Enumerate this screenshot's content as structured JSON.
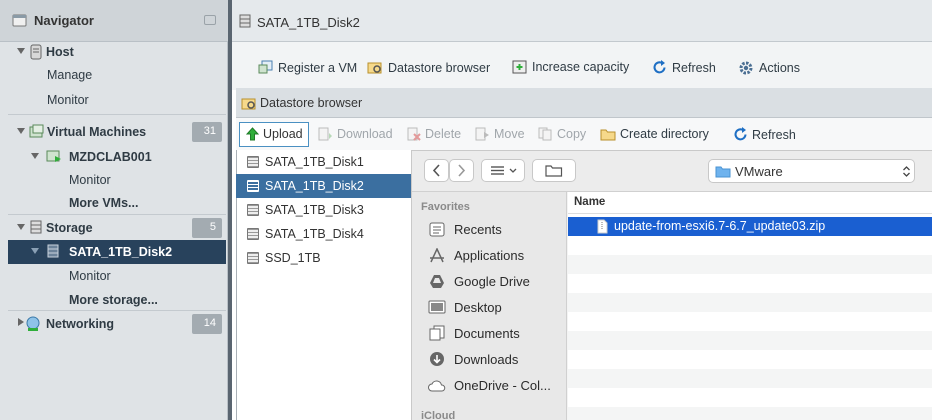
{
  "navigator": {
    "title": "Navigator",
    "host": {
      "label": "Host",
      "children": [
        "Manage",
        "Monitor"
      ]
    },
    "vms": {
      "label": "Virtual Machines",
      "count": "31",
      "vm": "MZDCLAB001",
      "vm_children": [
        "Monitor",
        "More VMs..."
      ]
    },
    "storage": {
      "label": "Storage",
      "count": "5",
      "ds": "SATA_1TB_Disk2",
      "ds_children": [
        "Monitor",
        "More storage..."
      ]
    },
    "networking": {
      "label": "Networking",
      "count": "14"
    }
  },
  "main": {
    "title": "SATA_1TB_Disk2",
    "toolbar": [
      "Register a VM",
      "Datastore browser",
      "Increase capacity",
      "Refresh",
      "Actions"
    ]
  },
  "dialog": {
    "title": "Datastore browser",
    "toolbar": {
      "upload": "Upload",
      "download": "Download",
      "delete": "Delete",
      "move": "Move",
      "copy": "Copy",
      "create_dir": "Create directory",
      "refresh": "Refresh"
    },
    "datastores": [
      "SATA_1TB_Disk1",
      "SATA_1TB_Disk2",
      "SATA_1TB_Disk3",
      "SATA_1TB_Disk4",
      "SSD_1TB"
    ],
    "selected_datastore": "SATA_1TB_Disk2"
  },
  "file_dialog": {
    "location": "VMware",
    "favorites_header": "Favorites",
    "favorites": [
      "Recents",
      "Applications",
      "Google Drive",
      "Desktop",
      "Documents",
      "Downloads",
      "OneDrive - Col..."
    ],
    "icloud_header": "iCloud",
    "column_name": "Name",
    "files": [
      "update-from-esxi6.7-6.7_update03.zip"
    ]
  },
  "colors": {
    "nav_selected": "#28425c",
    "ds_selected": "#3b6fa0",
    "file_selected": "#1a5fd1",
    "upload_icon": "#2fae3a",
    "refresh_icon": "#1e6fc4"
  }
}
